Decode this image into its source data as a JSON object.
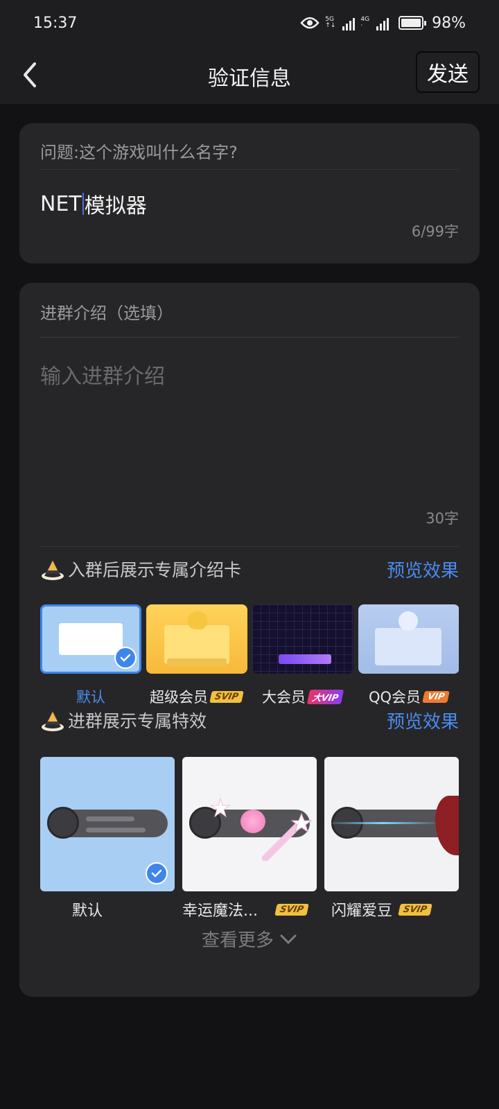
{
  "status_bar": {
    "time": "15:37",
    "battery": "98%",
    "battery_level": 0.98,
    "net1": "5G",
    "net2": "4G"
  },
  "nav": {
    "title": "验证信息",
    "send_label": "发送"
  },
  "question_card": {
    "question": "问题:这个游戏叫什么名字?",
    "answer_before_caret": "NET",
    "answer_after_caret": "模拟器",
    "counter": "6/99字"
  },
  "intro_card": {
    "label": "进群介绍（选填）",
    "placeholder": "输入进群介绍",
    "counter": "30字",
    "card_section": {
      "title": "入群后展示专属介绍卡",
      "preview": "预览效果",
      "items": [
        {
          "label": "默认",
          "badge": "",
          "selected": true
        },
        {
          "label": "超级会员",
          "badge": "SVIP"
        },
        {
          "label": "大会员",
          "badge": "大VIP"
        },
        {
          "label": "QQ会员",
          "badge": "VIP"
        }
      ]
    },
    "effect_section": {
      "title": "进群展示专属特效",
      "preview": "预览效果",
      "items": [
        {
          "label": "默认",
          "badge": "",
          "selected": true
        },
        {
          "label": "幸运魔法...",
          "badge": "SVIP"
        },
        {
          "label": "闪耀爱豆",
          "badge": "SVIP"
        }
      ]
    },
    "more": "查看更多"
  },
  "colors": {
    "accent": "#4a8bf0",
    "check": "#3e86ea",
    "svip": "#f0c040",
    "background": "#121214",
    "card": "#262628"
  }
}
